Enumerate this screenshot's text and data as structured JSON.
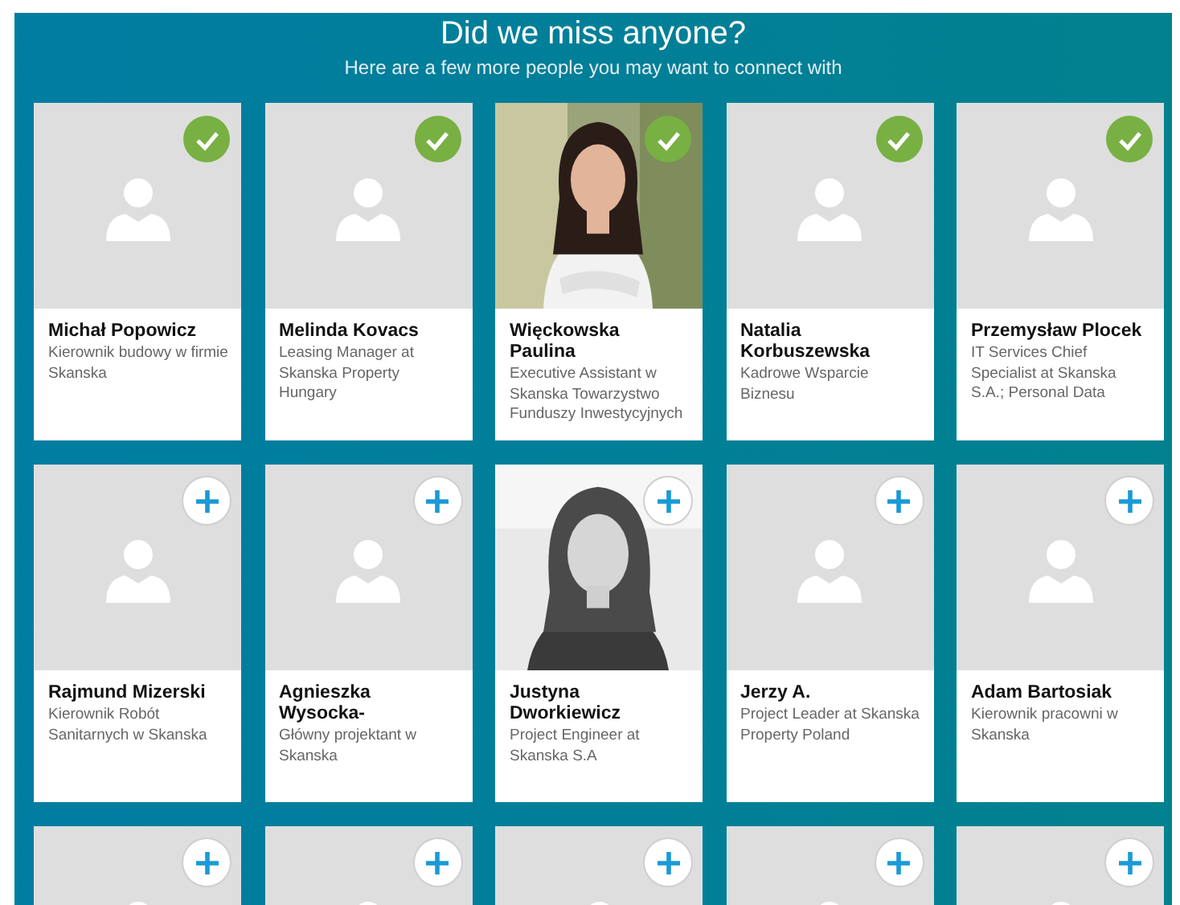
{
  "header": {
    "title": "Did we miss anyone?",
    "subtitle": "Here are a few more people you may want to connect with"
  },
  "people": [
    {
      "name": "Michał Popowicz",
      "headline": "Kierownik budowy w firmie Skanska",
      "kind": "placeholder",
      "added": true
    },
    {
      "name": "Melinda Kovacs",
      "headline": "Leasing Manager at Skanska Property Hungary",
      "kind": "placeholder",
      "added": true
    },
    {
      "name": "Więckowska Paulina",
      "headline": "Executive Assistant w Skanska Towarzystwo Funduszy Inwestycyjnych",
      "kind": "picture",
      "added": true
    },
    {
      "name": "Natalia Korbuszewska",
      "headline": "Kadrowe Wsparcie Biznesu",
      "kind": "placeholder",
      "added": true
    },
    {
      "name": "Przemysław Plocek",
      "headline": "IT Services Chief Specialist at Skanska S.A.; Personal Data",
      "kind": "placeholder",
      "added": true
    },
    {
      "name": "Rajmund Mizerski",
      "headline": "Kierownik Robót Sanitarnych w Skanska",
      "kind": "placeholder",
      "added": false
    },
    {
      "name": "Agnieszka Wysocka-",
      "headline": "Główny projektant w Skanska",
      "kind": "placeholder",
      "added": false
    },
    {
      "name": "Justyna Dworkiewicz",
      "headline": "Project Engineer at Skanska S.A",
      "kind": "picture",
      "added": false
    },
    {
      "name": "Jerzy A.",
      "headline": "Project Leader at Skanska Property Poland",
      "kind": "placeholder",
      "added": false
    },
    {
      "name": "Adam Bartosiak",
      "headline": "Kierownik pracowni w Skanska",
      "kind": "placeholder",
      "added": false
    },
    {
      "kind": "placeholder",
      "added": false
    },
    {
      "kind": "placeholder",
      "added": false
    },
    {
      "kind": "placeholder",
      "added": false
    },
    {
      "kind": "placeholder",
      "added": false
    },
    {
      "kind": "placeholder",
      "added": false
    }
  ]
}
